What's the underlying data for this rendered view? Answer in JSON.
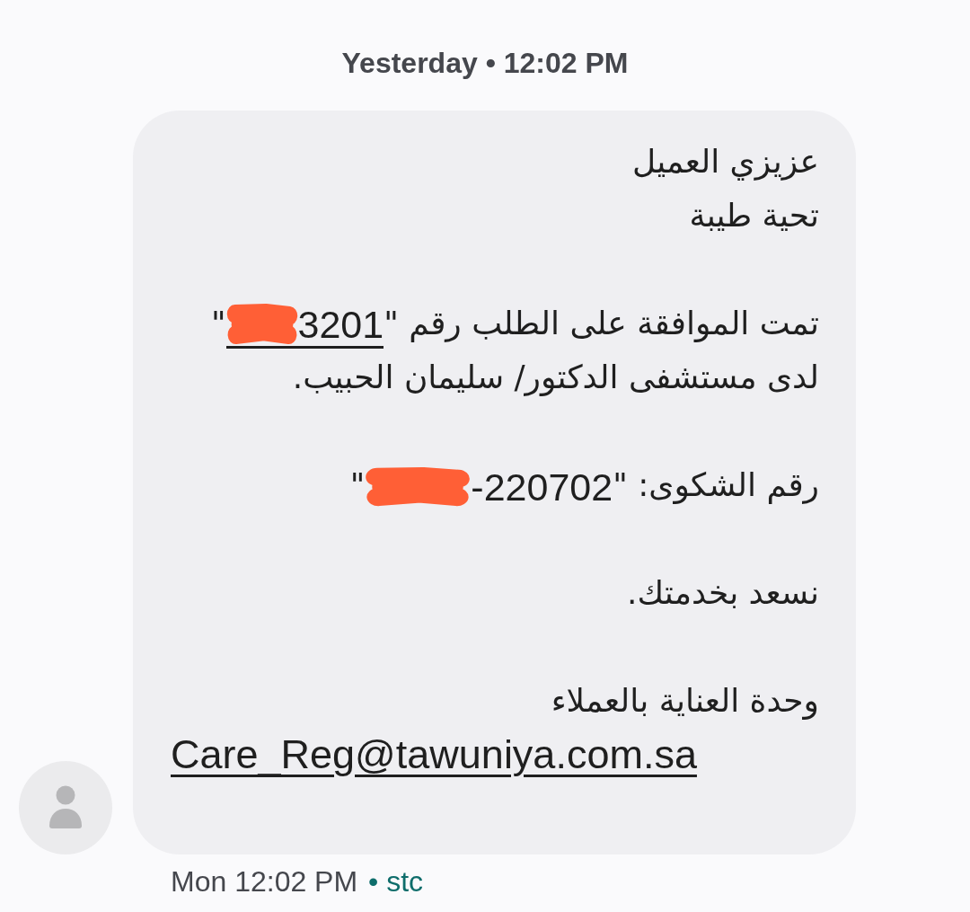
{
  "header": {
    "text": "Yesterday • 12:02 PM"
  },
  "message": {
    "paragraphs": [
      {
        "lines": [
          [
            {
              "kind": "text",
              "text": "عزيزي العميل"
            }
          ],
          [
            {
              "kind": "text",
              "text": "تحية طيبة"
            }
          ]
        ]
      },
      {
        "lines": [
          [
            {
              "kind": "text",
              "text": "تمت الموافقة على الطلب رقم \""
            },
            {
              "kind": "number",
              "underlined": true,
              "parts": [
                {
                  "kind": "redacted"
                },
                {
                  "kind": "text",
                  "text": "3201"
                }
              ]
            },
            {
              "kind": "text",
              "text": "\" لدى مستشفى الدكتور/ سليمان الحبيب."
            }
          ]
        ]
      },
      {
        "lines": [
          [
            {
              "kind": "text",
              "text": "رقم الشكوى: \""
            },
            {
              "kind": "number",
              "underlined": false,
              "parts": [
                {
                  "kind": "redacted"
                },
                {
                  "kind": "text",
                  "text": "-220702"
                }
              ]
            },
            {
              "kind": "text",
              "text": "\""
            }
          ]
        ]
      },
      {
        "lines": [
          [
            {
              "kind": "text",
              "text": "نسعد بخدمتك."
            }
          ]
        ]
      },
      {
        "lines": [
          [
            {
              "kind": "text",
              "text": "وحدة العناية بالعملاء"
            }
          ],
          [
            {
              "kind": "link",
              "text": "Care_Reg@tawuniya.com.sa"
            }
          ]
        ]
      }
    ]
  },
  "footer": {
    "time": "Mon 12:02 PM",
    "carrier": "• stc"
  }
}
